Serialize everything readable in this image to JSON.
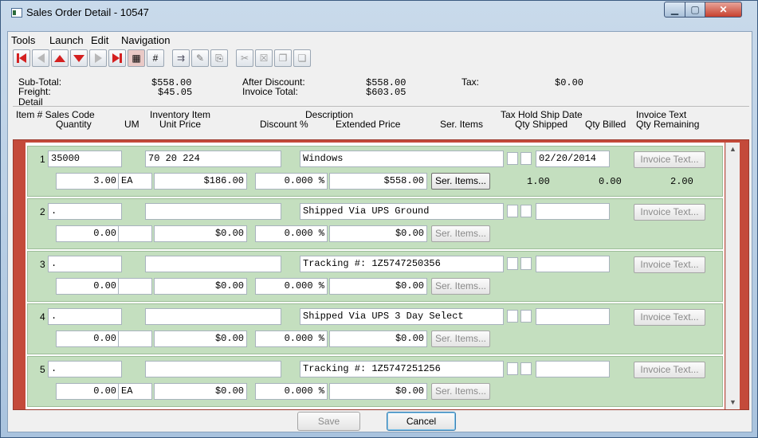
{
  "window": {
    "title": "Sales Order Detail - 10547"
  },
  "menu": [
    "Tools",
    "Launch",
    "Edit",
    "Navigation"
  ],
  "toolbar_icons": [
    "first-record-icon",
    "previous-icon",
    "move-up-icon",
    "move-down-icon",
    "next-icon",
    "last-record-icon",
    "grid-icon",
    "number-icon",
    "columns-icon",
    "edit-icon",
    "paste-icon",
    "cut-icon",
    "delete-icon",
    "copy-icon",
    "clipboard-icon"
  ],
  "totals": {
    "subtotal_label": "Sub-Total:",
    "subtotal": "$558.00",
    "freight_label": "Freight:",
    "freight": "$45.05",
    "after_discount_label": "After Discount:",
    "after_discount": "$558.00",
    "invoice_total_label": "Invoice Total:",
    "invoice_total": "$603.05",
    "tax_label": "Tax:",
    "tax": "$0.00"
  },
  "detail_label": "Detail",
  "headers": {
    "line1": {
      "item_sales_code": "Item # Sales Code",
      "inventory_item": "Inventory Item",
      "description": "Description",
      "tax_hold_ship": "Tax Hold Ship Date",
      "invoice_text": "Invoice Text"
    },
    "line2": {
      "quantity": "Quantity",
      "um": "UM",
      "unit_price": "Unit Price",
      "discount": "Discount %",
      "extended_price": "Extended Price",
      "ser_items": "Ser. Items",
      "qty_shipped": "Qty Shipped",
      "qty_billed": "Qty Billed",
      "qty_remaining": "Qty Remaining"
    }
  },
  "rows": [
    {
      "num": "1",
      "sales_code": "35000",
      "inventory_item": "70  20  224",
      "description": "Windows",
      "ship_date": "02/20/2014",
      "quantity": "3.00",
      "um": "EA",
      "unit_price": "$186.00",
      "discount": "0.000 %",
      "extended_price": "$558.00",
      "ser_items": "Ser. Items...",
      "invoice_text": "Invoice Text...",
      "qty_shipped": "1.00",
      "qty_billed": "0.00",
      "qty_remaining": "2.00"
    },
    {
      "num": "2",
      "sales_code": ".",
      "inventory_item": "",
      "description": "Shipped Via UPS Ground",
      "ship_date": "",
      "quantity": "0.00",
      "um": "",
      "unit_price": "$0.00",
      "discount": "0.000 %",
      "extended_price": "$0.00",
      "ser_items": "Ser. Items...",
      "invoice_text": "Invoice Text..."
    },
    {
      "num": "3",
      "sales_code": ".",
      "inventory_item": "",
      "description": "Tracking #: 1Z5747250356",
      "ship_date": "",
      "quantity": "0.00",
      "um": "",
      "unit_price": "$0.00",
      "discount": "0.000 %",
      "extended_price": "$0.00",
      "ser_items": "Ser. Items...",
      "invoice_text": "Invoice Text..."
    },
    {
      "num": "4",
      "sales_code": ".",
      "inventory_item": "",
      "description": "Shipped Via UPS 3 Day Select",
      "ship_date": "",
      "quantity": "0.00",
      "um": "",
      "unit_price": "$0.00",
      "discount": "0.000 %",
      "extended_price": "$0.00",
      "ser_items": "Ser. Items...",
      "invoice_text": "Invoice Text..."
    },
    {
      "num": "5",
      "sales_code": ".",
      "inventory_item": "",
      "description": "Tracking #: 1Z5747251256",
      "ship_date": "",
      "quantity": "0.00",
      "um": "EA",
      "unit_price": "$0.00",
      "discount": "0.000 %",
      "extended_price": "$0.00",
      "ser_items": "Ser. Items...",
      "invoice_text": "Invoice Text..."
    }
  ],
  "buttons": {
    "save": "Save",
    "cancel": "Cancel"
  }
}
